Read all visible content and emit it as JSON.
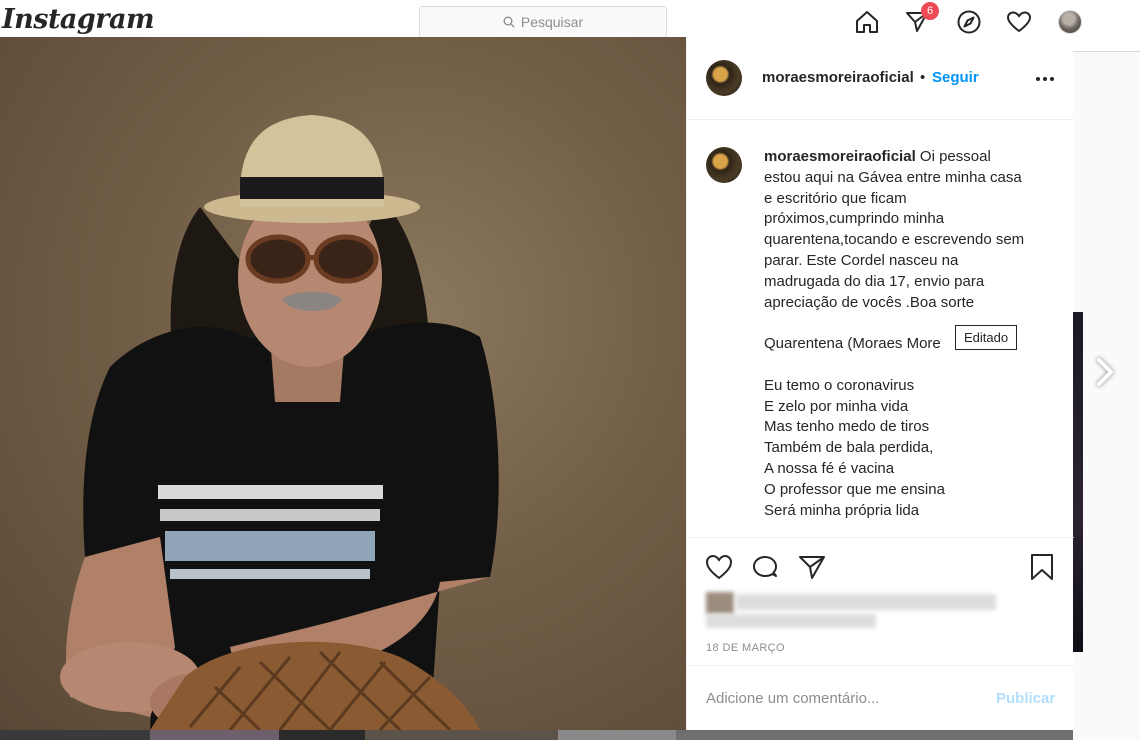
{
  "nav": {
    "logo": "Instagram",
    "search_placeholder": "Pesquisar",
    "inbox_badge": "6",
    "icons": [
      "home-icon",
      "direct-icon",
      "explore-icon",
      "activity-heart-icon",
      "profile-avatar"
    ]
  },
  "post": {
    "username": "moraesmoreiraoficial",
    "separator": "•",
    "follow_label": "Seguir",
    "more_icon": "more-options-icon",
    "caption_user": "moraesmoreiraoficial",
    "caption_body": " Oi pessoal\nestou aqui na Gávea entre minha casa\ne escritório que ficam\npróximos,cumprindo minha\nquarentena,tocando e escrevendo sem\nparar. Este Cordel nasceu na\nmadrugada do dia 17, envio para\napreciação de vocês .Boa sorte\n\nQuarentena (Moraes More\n\nEu temo o coronavirus\nE zelo por minha vida\nMas tenho medo de tiros\nTambém de bala perdida,\nA nossa fé é vacina\nO professor que me ensina\nSerá minha própria lida",
    "tooltip": "Editado",
    "date": "18 DE MARÇO",
    "comment_placeholder": "Adicione um comentário...",
    "publish_label": "Publicar"
  },
  "colors": {
    "accent": "#0095f6",
    "badge": "#ed4956",
    "publish_disabled": "#b2dffc"
  }
}
